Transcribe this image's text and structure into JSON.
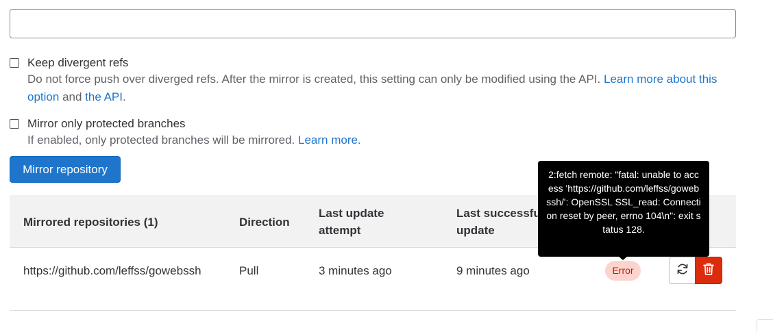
{
  "input": {
    "value": "",
    "placeholder": ""
  },
  "keep_divergent": {
    "label": "Keep divergent refs",
    "help_text": "Do not force push over diverged refs. After the mirror is created, this setting can only be modified using the API.",
    "link1": "Learn more about this option",
    "and_text": "and",
    "link2": "the API",
    "period": "."
  },
  "protected_only": {
    "label": "Mirror only protected branches",
    "help_text": "If enabled, only protected branches will be mirrored.",
    "link": "Learn more."
  },
  "mirror_button_label": "Mirror repository",
  "table": {
    "headers": {
      "repos": "Mirrored repositories (1)",
      "direction": "Direction",
      "last_update_1": "Last update",
      "last_update_2": "attempt",
      "last_success_1": "Last successful",
      "last_success_2": "update"
    },
    "rows": [
      {
        "url": "https://github.com/leffss/gowebssh",
        "direction": "Pull",
        "last_update": "3 minutes ago",
        "last_success": "9 minutes ago",
        "status": "Error"
      }
    ]
  },
  "tooltip": "2:fetch remote: \"fatal: unable to access 'https://github.com/leffss/gowebssh/': OpenSSL SSL_read: Connection reset by peer, errno 104\\n\": exit status 128.",
  "colors": {
    "primary": "#1f75cb",
    "danger": "#dd2b0e",
    "error_badge_bg": "#fdd4cd",
    "error_badge_text": "#c91c00"
  },
  "icons": {
    "sync": "sync-icon",
    "delete": "trash-icon"
  }
}
